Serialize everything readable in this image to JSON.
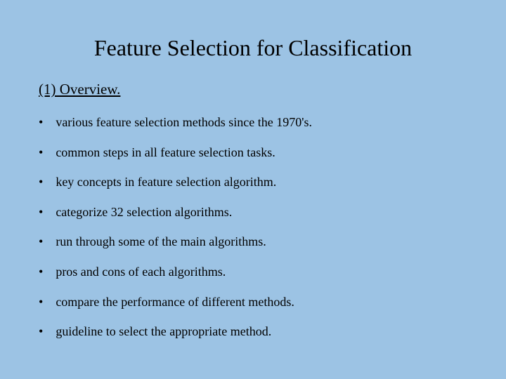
{
  "title": "Feature Selection for Classification",
  "section_heading": "(1) Overview.",
  "bullets": [
    "various feature selection methods since the 1970's.",
    "common steps in all feature selection tasks.",
    "key concepts in feature selection algorithm.",
    "categorize 32 selection algorithms.",
    "run through some of the main algorithms.",
    "pros and cons of each algorithms.",
    "compare the performance of different methods.",
    "guideline to select the appropriate method."
  ]
}
